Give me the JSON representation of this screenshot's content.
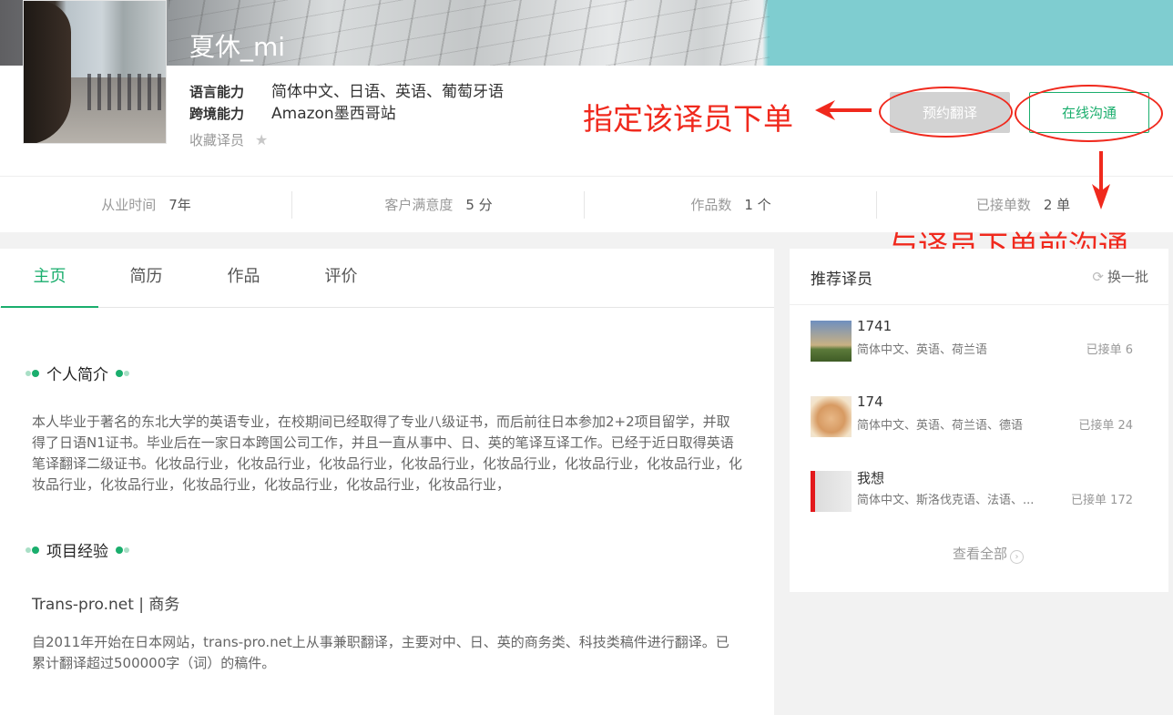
{
  "profile": {
    "name": "夏休_mi",
    "language_label": "语言能力",
    "language_value": "简体中文、日语、英语、葡萄牙语",
    "cross_label": "跨境能力",
    "cross_value": "Amazon墨西哥站",
    "favorite_label": "收藏译员",
    "favorite_icon": "star-icon",
    "book_button": "预约翻译",
    "chat_button": "在线沟通"
  },
  "stats": [
    {
      "label": "从业时间",
      "value": "7年"
    },
    {
      "label": "客户满意度",
      "value": "5 分"
    },
    {
      "label": "作品数",
      "value": "1 个"
    },
    {
      "label": "已接单数",
      "value": "2 单"
    }
  ],
  "annotations": {
    "book_note": "指定该译员下单",
    "chat_note": "与译员下单前沟通",
    "color": "#f0291d"
  },
  "tabs": [
    "主页",
    "简历",
    "作品",
    "评价"
  ],
  "intro": {
    "title": "个人简介",
    "text": "本人毕业于著名的东北大学的英语专业，在校期间已经取得了专业八级证书，而后前往日本参加2+2项目留学，并取得了日语N1证书。毕业后在一家日本跨国公司工作，并且一直从事中、日、英的笔译互译工作。已经于近日取得英语笔译翻译二级证书。化妆品行业，化妆品行业，化妆品行业，化妆品行业，化妆品行业，化妆品行业，化妆品行业，化妆品行业，化妆品行业，化妆品行业，化妆品行业，化妆品行业，化妆品行业，"
  },
  "project": {
    "title": "项目经验",
    "heading": "Trans-pro.net | 商务",
    "text": "自2011年开始在日本网站，trans-pro.net上从事兼职翻译，主要对中、日、英的商务类、科技类稿件进行翻译。已累计翻译超过500000字（词）的稿件。"
  },
  "recommend": {
    "title": "推荐译员",
    "refresh_label": "换一批",
    "refresh_icon": "refresh-icon",
    "items": [
      {
        "name": "1741",
        "languages": "简体中文、英语、荷兰语",
        "orders": "已接单 6"
      },
      {
        "name": "174",
        "languages": "简体中文、英语、荷兰语、德语",
        "orders": "已接单 24"
      },
      {
        "name": "我想",
        "languages": "简体中文、斯洛伐克语、法语、...",
        "orders": "已接单 172"
      }
    ],
    "view_all": "查看全部",
    "view_all_icon": "chevron-right-circle-icon"
  },
  "colors": {
    "accent": "#1aae6d",
    "annotation": "#f0291d"
  }
}
